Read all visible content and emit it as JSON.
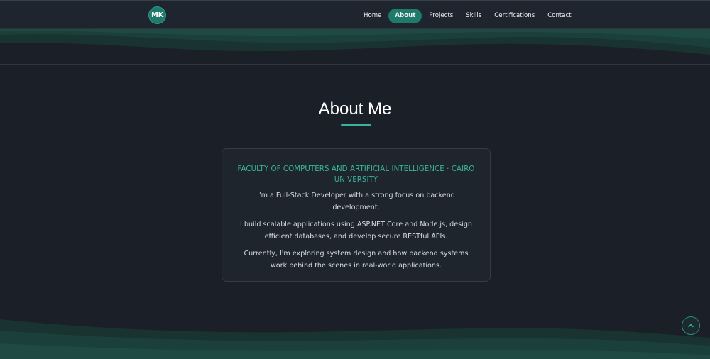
{
  "logo": {
    "text": "MK"
  },
  "nav": {
    "items": [
      {
        "label": "Home"
      },
      {
        "label": "About"
      },
      {
        "label": "Projects"
      },
      {
        "label": "Skills"
      },
      {
        "label": "Certifications"
      },
      {
        "label": "Contact"
      }
    ],
    "active": "About"
  },
  "about": {
    "title": "About Me",
    "heading": "FACULTY OF COMPUTERS AND ARTIFICIAL INTELLIGENCE · CAIRO UNIVERSITY",
    "paragraphs": [
      "I'm a Full-Stack Developer with a strong focus on backend development.",
      "I build scalable applications using ASP.NET Core and Node.js, design efficient databases, and develop secure RESTful APIs.",
      "Currently, I'm exploring system design and how backend systems work behind the scenes in real-world applications."
    ]
  },
  "scroll_top": {
    "icon": "chevron-up-icon"
  },
  "colors": {
    "background": "#1b2028",
    "accent": "#1f7a6b",
    "accent_text": "#3bb39c",
    "card": "#1e252d"
  }
}
